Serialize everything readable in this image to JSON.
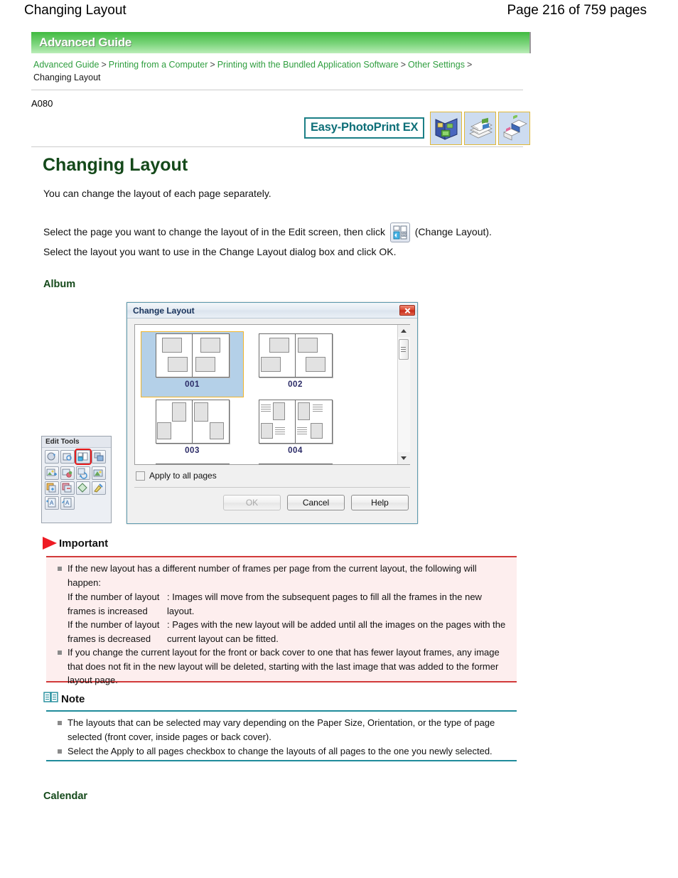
{
  "page_header": {
    "title": "Changing Layout",
    "page_indicator": "Page 216 of 759 pages"
  },
  "guide_banner": {
    "label": "Advanced Guide"
  },
  "breadcrumb": {
    "items": [
      "Advanced Guide",
      "Printing from a Computer",
      "Printing with the Bundled Application Software",
      "Other Settings"
    ],
    "current": "Changing Layout",
    "separator": ">"
  },
  "doc_id": "A080",
  "product_logo": {
    "label": "Easy-PhotoPrint EX",
    "icons": [
      "album-icon",
      "photo-stack-icon",
      "calendar-icon"
    ]
  },
  "main": {
    "heading": "Changing Layout",
    "intro": "You can change the layout of each page separately.",
    "step_line1_before": "Select the page you want to change the layout of in the Edit screen, then click",
    "step_line1_after": "(Change Layout).",
    "step_line2": "Select the layout you want to use in the Change Layout dialog box and click OK.",
    "section_album": "Album",
    "section_calendar": "Calendar"
  },
  "dialog": {
    "title": "Change Layout",
    "close_label": "Close",
    "layouts": [
      {
        "label": "001",
        "selected": true
      },
      {
        "label": "002",
        "selected": false
      },
      {
        "label": "003",
        "selected": false
      },
      {
        "label": "004",
        "selected": false
      }
    ],
    "apply_all_label": "Apply to all pages",
    "apply_all_checked": false,
    "buttons": {
      "ok": "OK",
      "ok_disabled": true,
      "cancel": "Cancel",
      "help": "Help"
    }
  },
  "edit_tools": {
    "title": "Edit Tools",
    "highlighted_tool": "change-layout-tool",
    "rows": [
      [
        "rotate-tool",
        "trim-tool",
        "change-layout-tool",
        "change-background-tool"
      ],
      [
        "add-image-tool",
        "swap-image-tool",
        "replace-image-tool",
        "image-effects-tool"
      ],
      [
        "add-page-tool",
        "delete-page-tool",
        "clip-art-tool",
        "decorate-tool"
      ],
      [
        "add-text-tool",
        "edit-text-tool"
      ]
    ]
  },
  "important": {
    "heading": "Important",
    "items": [
      "If the new layout has a different number of frames per page from the current layout, the following will happen:",
      "If you change the current layout for the front or back cover to one that has fewer layout frames, any image that does not fit in the new layout will be deleted, starting with the last image that was added to the former layout page."
    ],
    "definitions": [
      {
        "term": "If the number of layout frames is increased",
        "desc": ": Images will move from the subsequent pages to fill all the frames in the new layout."
      },
      {
        "term": "If the number of layout frames is decreased",
        "desc": ": Pages with the new layout will be added until all the images on the pages with the current layout can be fitted."
      }
    ]
  },
  "note": {
    "heading": "Note",
    "items": [
      "The layouts that can be selected may vary depending on the Paper Size, Orientation, or the type of page selected (front cover, inside pages or back cover).",
      "Select the Apply to all pages checkbox to change the layouts of all pages to the one you newly selected."
    ]
  },
  "colors": {
    "banner_green": "#3fb93f",
    "heading_green": "#14491a",
    "link_green": "#2f9e3f",
    "logo_teal": "#0e6f78",
    "important_red": "#d23a3a",
    "note_teal": "#1f8b9b",
    "selection_orange": "#f0b429",
    "selection_blue": "#b4d0e8"
  }
}
